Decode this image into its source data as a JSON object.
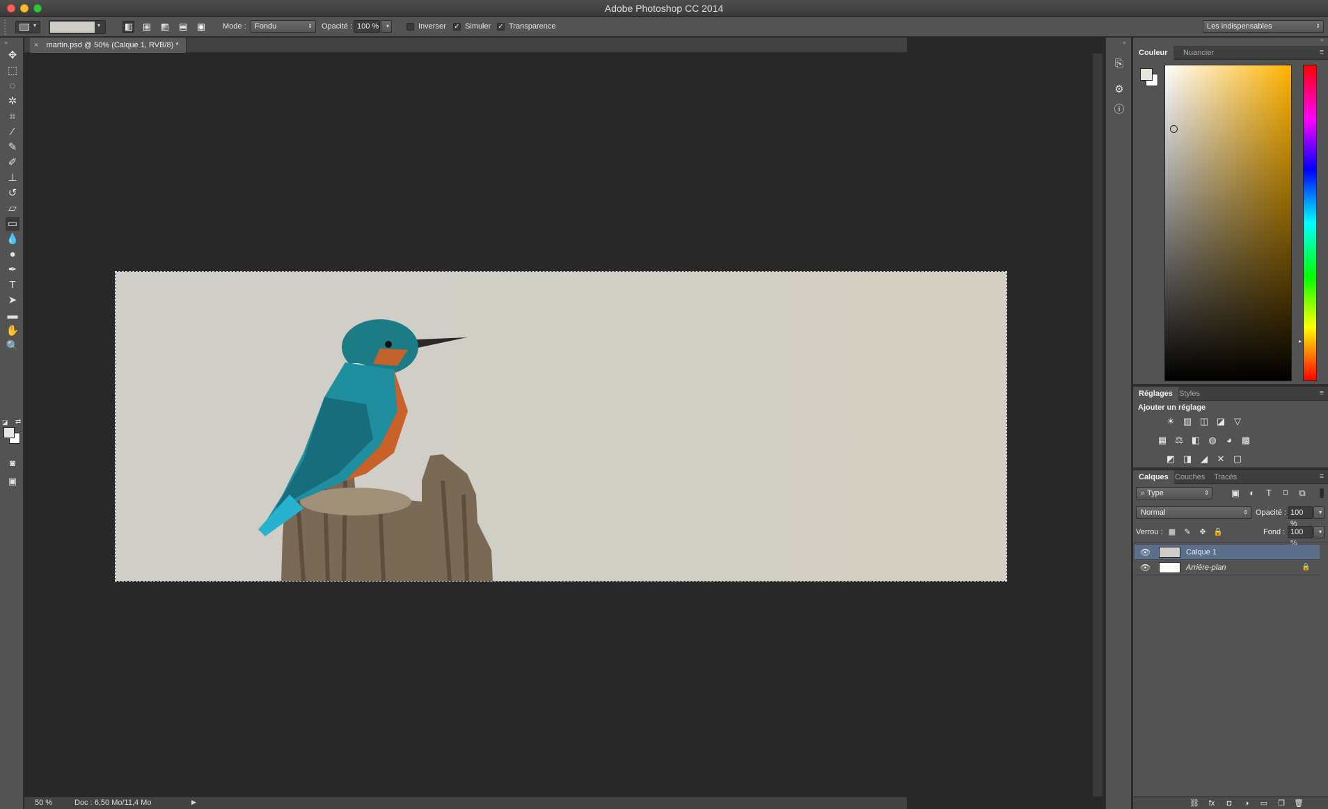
{
  "window": {
    "title": "Adobe Photoshop CC 2014"
  },
  "options_bar": {
    "mode_label": "Mode :",
    "mode_value": "Fondu",
    "opacity_label": "Opacité :",
    "opacity_value": "100 %",
    "checkboxes": [
      {
        "label": "Inverser",
        "checked": false
      },
      {
        "label": "Simuler",
        "checked": true
      },
      {
        "label": "Transparence",
        "checked": true
      }
    ],
    "workspace": "Les indispensables",
    "gradient_preview_color": "#cfcdc6"
  },
  "document": {
    "tab_title": "martin.psd @ 50% (Calque 1, RVB/8) *",
    "close_glyph": "×",
    "zoom": "50 %",
    "doc_info": "Doc : 6,50 Mo/11,4 Mo",
    "status_arrow": "▶"
  },
  "tools": [
    {
      "name": "move-tool-icon",
      "glyph": "✥"
    },
    {
      "name": "marquee-tool-icon",
      "glyph": "⬚"
    },
    {
      "name": "lasso-tool-icon",
      "glyph": "◌"
    },
    {
      "name": "magic-wand-tool-icon",
      "glyph": "✲"
    },
    {
      "name": "crop-tool-icon",
      "glyph": "⌗"
    },
    {
      "name": "eyedropper-tool-icon",
      "glyph": "⁄"
    },
    {
      "name": "healing-brush-tool-icon",
      "glyph": "✎"
    },
    {
      "name": "brush-tool-icon",
      "glyph": "✐"
    },
    {
      "name": "stamp-tool-icon",
      "glyph": "⊥"
    },
    {
      "name": "history-brush-tool-icon",
      "glyph": "↺"
    },
    {
      "name": "eraser-tool-icon",
      "glyph": "▱"
    },
    {
      "name": "gradient-tool-icon",
      "glyph": "▭"
    },
    {
      "name": "blur-tool-icon",
      "glyph": "💧"
    },
    {
      "name": "dodge-tool-icon",
      "glyph": "●"
    },
    {
      "name": "pen-tool-icon",
      "glyph": "✒"
    },
    {
      "name": "type-tool-icon",
      "glyph": "T"
    },
    {
      "name": "path-selection-tool-icon",
      "glyph": "➤"
    },
    {
      "name": "shape-tool-icon",
      "glyph": "▬"
    },
    {
      "name": "hand-tool-icon",
      "glyph": "✋"
    },
    {
      "name": "zoom-tool-icon",
      "glyph": "🔍"
    }
  ],
  "color_panel": {
    "tabs": [
      "Couleur",
      "Nuancier"
    ],
    "foreground": "#e8e6e0",
    "background": "#ffffff",
    "menu_glyph": "≡"
  },
  "adjustments_panel": {
    "tabs": [
      "Réglages",
      "Styles"
    ],
    "heading": "Ajouter un réglage",
    "row1": [
      "☀",
      "▥",
      "◫",
      "◪",
      "▽"
    ],
    "row2": [
      "▦",
      "⚖",
      "◧",
      "◍",
      "◕",
      "▩"
    ],
    "row3": [
      "◩",
      "◨",
      "◢",
      "✕",
      "▢"
    ]
  },
  "layers_panel": {
    "tabs": [
      "Calques",
      "Couches",
      "Tracés"
    ],
    "filter": "⌕ Type",
    "blend_mode": "Normal",
    "opacity_label": "Opacité :",
    "opacity_value": "100 %",
    "lock_label": "Verrou :",
    "fill_label": "Fond :",
    "fill_value": "100 %",
    "filter_icons": [
      "▣",
      "◐",
      "T",
      "⌑",
      "⧉"
    ],
    "lock_icons": [
      "▦",
      "✎",
      "✥",
      "🔒"
    ],
    "layers": [
      {
        "name": "Calque 1",
        "selected": true
      },
      {
        "name": "Arrière-plan",
        "selected": false,
        "locked": true
      }
    ],
    "footer_icons": [
      "⛓",
      "fx",
      "◘",
      "◑",
      "▭",
      "❐",
      "🗑"
    ],
    "eye_glyph": "👁",
    "lock_glyph": "🔒"
  }
}
